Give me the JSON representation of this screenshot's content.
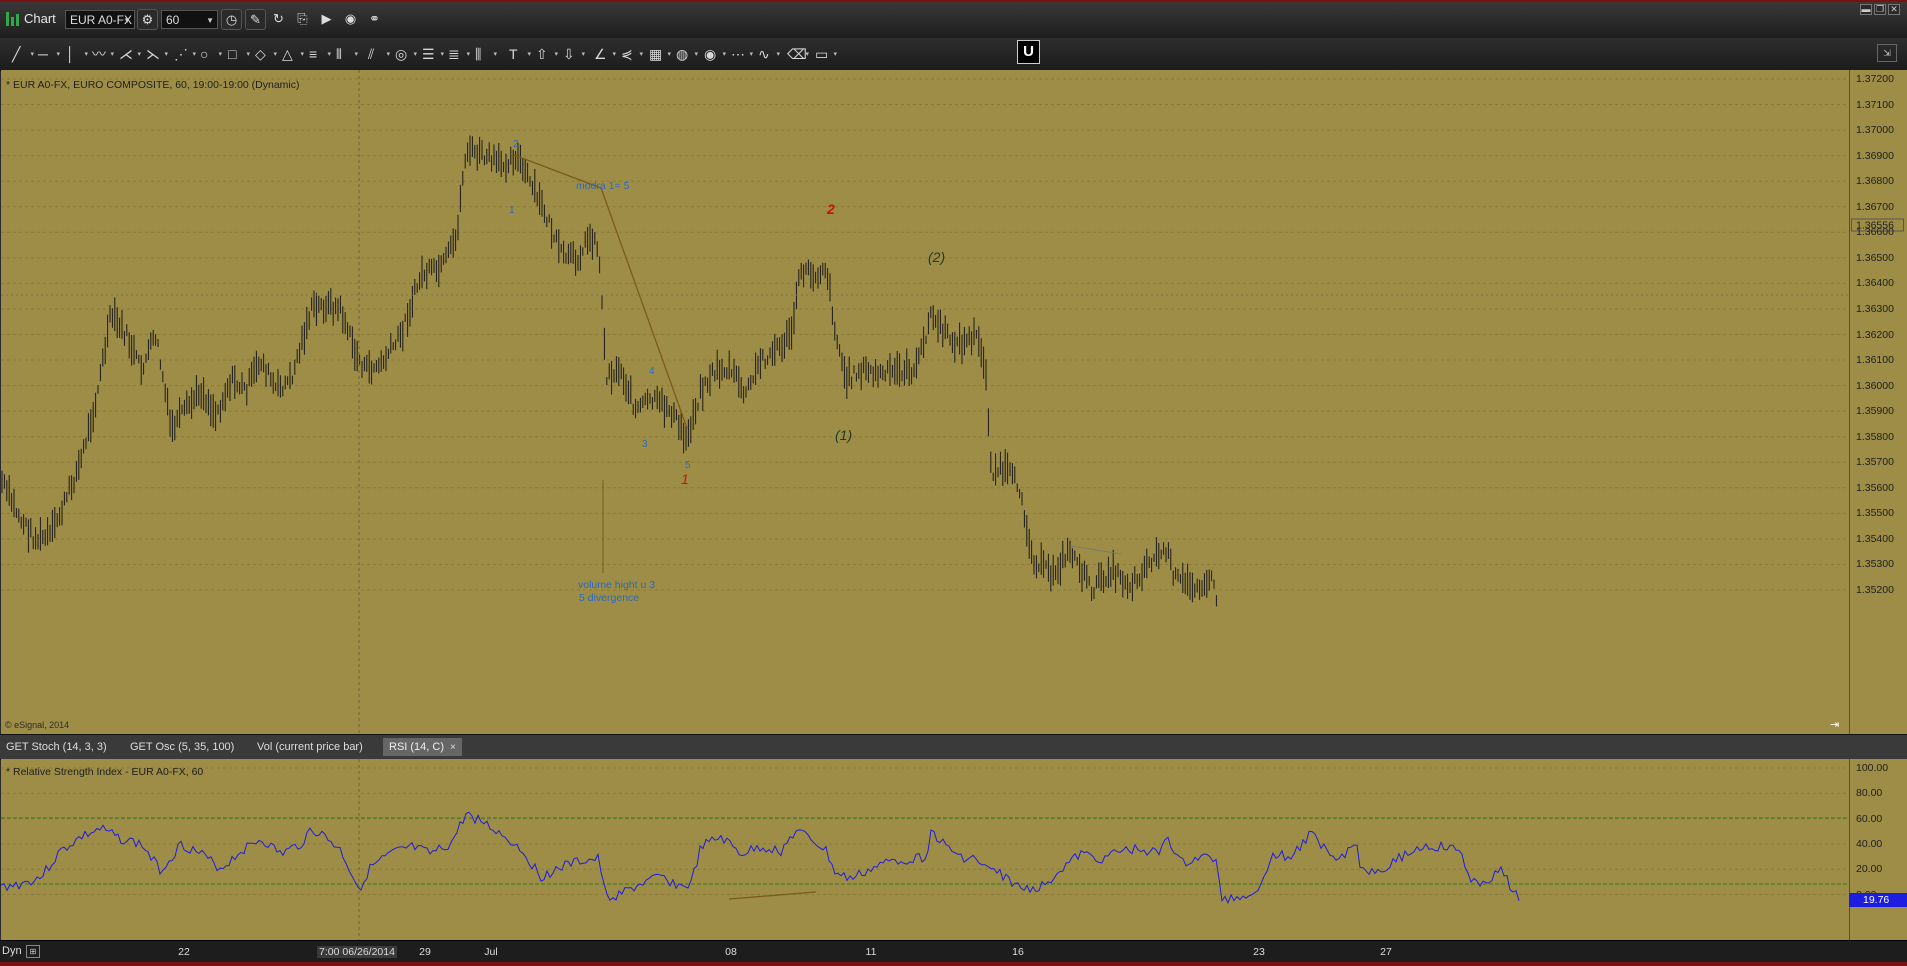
{
  "window": {
    "title": "Chart",
    "symbol": "EUR A0-FX",
    "interval": "60"
  },
  "toolbar_icons": [
    "line-tool-icon",
    "horizontal-line-icon",
    "vertical-line-icon",
    "wave-tool-icon",
    "pitchfork-icon",
    "fan-icon",
    "gann-fan-icon",
    "ellipse-icon",
    "rectangle-icon",
    "diamond-icon",
    "triangle-icon",
    "channel-icon",
    "bar-pattern-icon",
    "parallel-lines-icon",
    "circles-icon",
    "horizontal-lines-icon",
    "fib-levels-icon",
    "vertical-lines-icon",
    "text-tool-icon",
    "arrow-up-icon",
    "arrow-down-icon",
    "angle-icon",
    "arrow-fan-icon",
    "grid-icon",
    "cycle-icon",
    "eye-icon",
    "pti-icon",
    "regression-icon",
    "eraser-icon",
    "comment-icon",
    "magnet-icon"
  ],
  "price_chart": {
    "header": "* EUR A0-FX, EURO COMPOSITE, 60, 19:00-19:00 (Dynamic)",
    "copyright": "© eSignal, 2014",
    "y_labels": [
      "1.37200",
      "1.37100",
      "1.37000",
      "1.36900",
      "1.36800",
      "1.36700",
      "1.36600",
      "1.36500",
      "1.36400",
      "1.36300",
      "1.36200",
      "1.36100",
      "1.36000",
      "1.35900",
      "1.35800",
      "1.35700",
      "1.35600",
      "1.35500",
      "1.35400",
      "1.35300",
      "1.35200"
    ],
    "current_price": "1.36556",
    "annotations": {
      "wave_2_small": "2",
      "wave_1_small": "1",
      "modra": "modra 1= 5",
      "wave_4_small": "4",
      "wave_3_small": "3",
      "wave_5_small": "5",
      "red_1": "1",
      "red_2": "2",
      "paren_1": "(1)",
      "paren_2": "(2)",
      "volume_note_1": "volume hight u 3",
      "volume_note_2": "5 divergence"
    },
    "colors": {
      "background": "#9e8d47",
      "bars": "#1a1a1a",
      "blue_label": "#2a6ac0",
      "red_label": "#cc1010",
      "trendline": "#7a5a1e"
    }
  },
  "indicator_tabs": [
    {
      "label": "GET Stoch (14, 3, 3)"
    },
    {
      "label": "GET Osc (5, 35, 100)"
    },
    {
      "label": "Vol (current price bar)"
    },
    {
      "label": "RSI (14, C)"
    }
  ],
  "rsi": {
    "header": "* Relative Strength Index - EUR A0-FX, 60",
    "y_labels": [
      "100.00",
      "80.00",
      "60.00",
      "40.00",
      "20.00",
      "0.00"
    ],
    "current_value": "19.76",
    "line_color": "#1d1de0"
  },
  "time_axis": {
    "mode": "Dyn",
    "labels": [
      "22",
      "7:00 06/26/2014",
      "29",
      "Jul",
      "08",
      "11",
      "16",
      "23",
      "27"
    ]
  }
}
